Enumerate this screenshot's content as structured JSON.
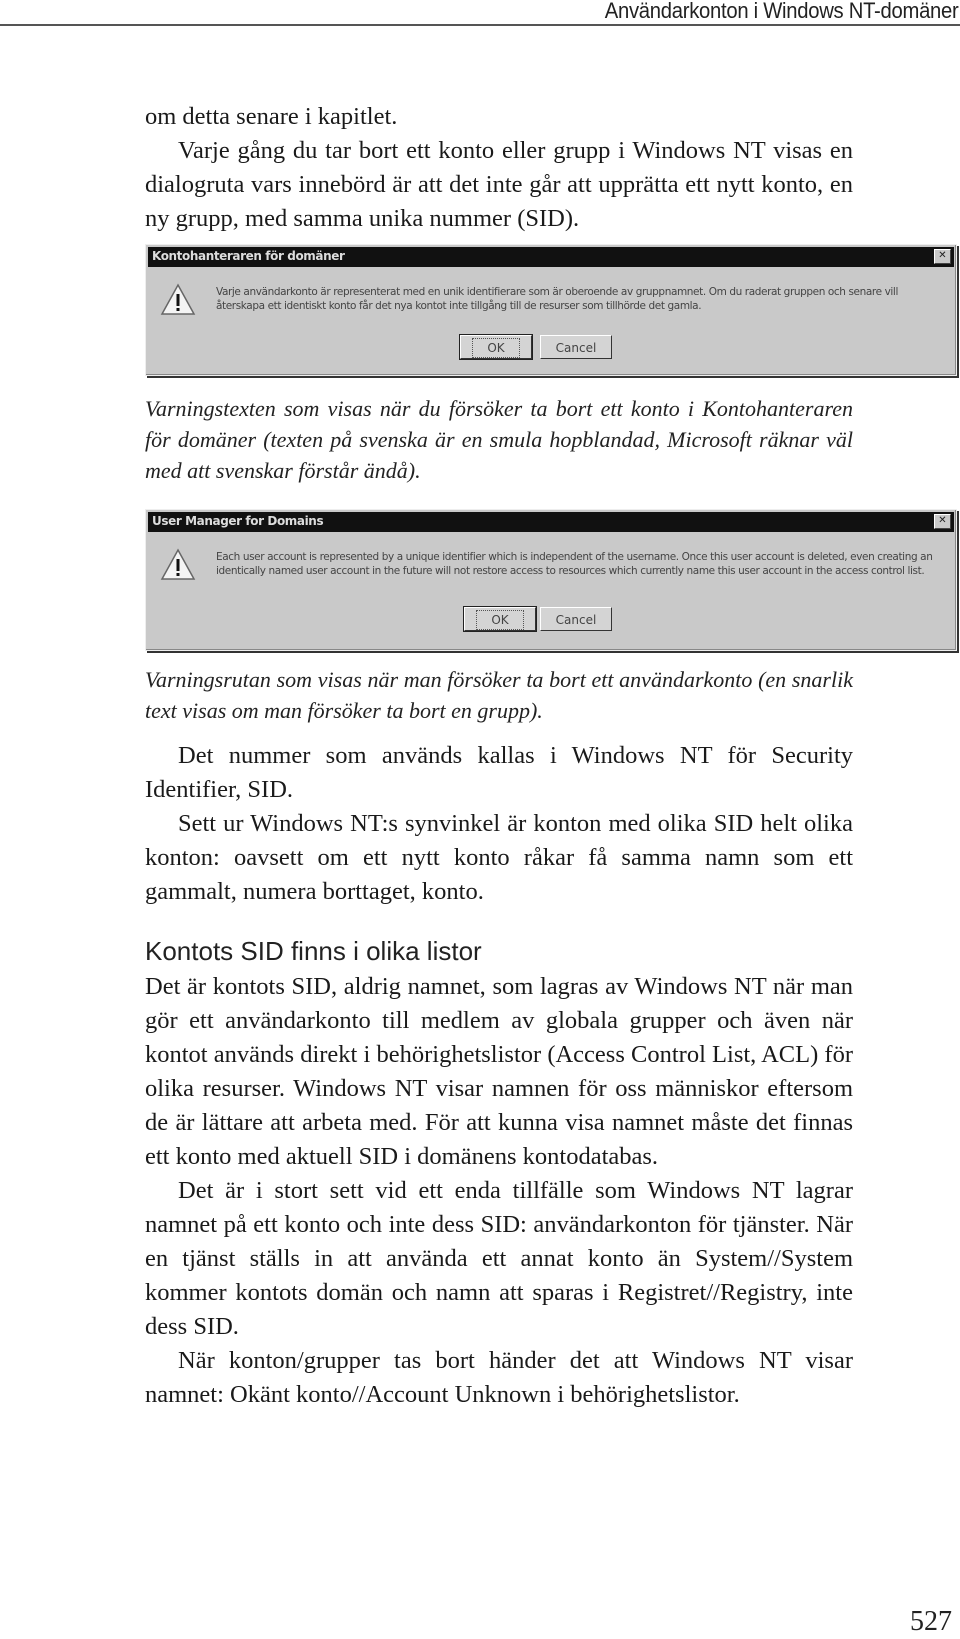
{
  "running_head": "Användarkonton i Windows NT-domäner",
  "intro": {
    "continuation": "om detta senare i kapitlet.",
    "paragraph": "Varje gång du tar bort ett konto eller grupp i Windows NT visas en dialogruta vars innebörd är att det inte går att upprätta ett nytt konto, en ny grupp, med samma unika nummer (SID)."
  },
  "dialog_swedish": {
    "title": "Kontohanteraren för domäner",
    "icon": "warning-icon",
    "message": "Varje användarkonto är representerat med en unik identifierare som är oberoende av gruppnamnet. Om du raderat gruppen och senare vill återskapa ett identiskt konto får det nya kontot inte tillgång till de resurser som tillhörde det gamla.",
    "ok_label": "OK",
    "cancel_label": "Cancel",
    "close_glyph": "✕"
  },
  "caption_swedish": "Varningstexten som visas när du försöker ta bort ett konto i Kontohanteraren för domäner (texten på svenska är en smula hopblandad, Microsoft räknar väl med att svenskar förstår ändå).",
  "dialog_english": {
    "title": "User Manager for Domains",
    "icon": "warning-icon",
    "message": "Each user account is represented by a unique identifier which is independent of the username. Once this user account is deleted, even creating an identically named user account in the future will not restore access to resources which currently name this user account in the access control list.",
    "ok_label": "OK",
    "cancel_label": "Cancel",
    "close_glyph": "✕"
  },
  "caption_english": "Varningsrutan som visas när man försöker ta bort ett användarkonto (en snarlik text visas om man försöker ta bort en grupp).",
  "paragraphs_a": [
    "Det nummer som används kallas i Windows NT för Security Identifier, SID.",
    "Sett ur Windows NT:s synvinkel är konton med olika SID helt olika konton: oavsett om ett nytt konto råkar få samma namn som ett gammalt, numera borttaget, konto."
  ],
  "section_heading": "Kontots SID finns i olika listor",
  "paragraphs_b": [
    "Det är kontots SID, aldrig namnet, som lagras av Windows NT när man gör ett användarkonto till medlem av globala grupper och även när kontot används direkt i behörighetslistor (Access Control List, ACL) för olika resurser. Windows NT visar namnen för oss människor eftersom de är lättare att arbeta med. För att kunna visa namnet måste det finnas ett konto med aktuell SID i domänens kontodatabas.",
    "Det är i stort sett vid ett enda tillfälle som Windows NT lagrar namnet på ett konto och inte dess SID: användarkonton för tjänster. När en tjänst ställs in att använda ett annat konto än System//System kommer kontots domän och namn att sparas i Registret//Registry, inte dess SID.",
    "När konton/grupper tas bort händer det att Windows NT visar namnet: Okänt konto//Account Unknown i behörighetslistor."
  ],
  "page_number": "527"
}
